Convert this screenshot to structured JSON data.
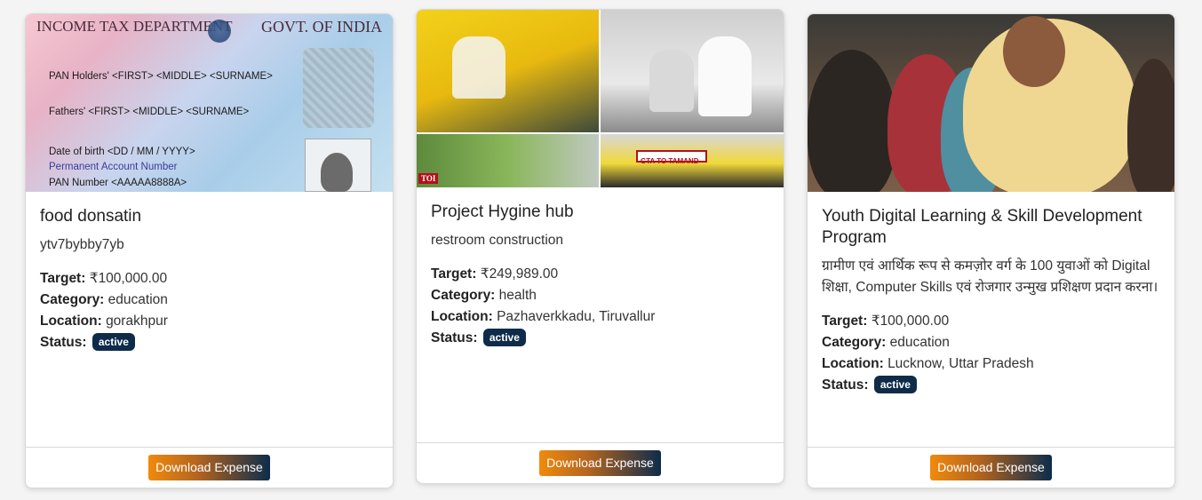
{
  "cards": [
    {
      "image_alt": "",
      "pan_card": {
        "header_left": "INCOME TAX DEPARTMENT",
        "header_right": "GOVT. OF INDIA",
        "line1": "PAN Holders' <FIRST> <MIDDLE> <SURNAME>",
        "line2": "Fathers' <FIRST> <MIDDLE> <SURNAME>",
        "line3": "Date of birth <DD / MM / YYYY>",
        "line4": "Permanent Account Number",
        "line5": "PAN Number <AAAAA8888A>"
      },
      "title": "food donsatin",
      "description": "ytv7bybby7yb",
      "target_label": "Target:",
      "target_value": "₹100,000.00",
      "category_label": "Category:",
      "category_value": "education",
      "location_label": "Location:",
      "location_value": "gorakhpur",
      "status_label": "Status:",
      "status_value": "active",
      "button_label": "Download Expense"
    },
    {
      "collage": {
        "toi_badge": "TOI",
        "bus_sign": "GTA TO TAMAND"
      },
      "title": "Project Hygine hub",
      "description": "restroom construction",
      "target_label": "Target:",
      "target_value": "₹249,989.00",
      "category_label": "Category:",
      "category_value": "health",
      "location_label": "Location:",
      "location_value": "Pazhaverkkadu, Tiruvallur",
      "status_label": "Status:",
      "status_value": "active",
      "button_label": "Download Expense"
    },
    {
      "title": "Youth Digital Learning & Skill Development Program",
      "description": "ग्रामीण एवं आर्थिक रूप से कमज़ोर वर्ग के 100 युवाओं को Digital शिक्षा, Computer Skills एवं रोजगार उन्मुख प्रशिक्षण प्रदान करना।",
      "target_label": "Target:",
      "target_value": "₹100,000.00",
      "category_label": "Category:",
      "category_value": "education",
      "location_label": "Location:",
      "location_value": "Lucknow, Uttar Pradesh",
      "status_label": "Status:",
      "status_value": "active",
      "button_label": "Download Expense"
    }
  ],
  "colors": {
    "badge": "#0e2c4a",
    "button_start": "#f08a0c",
    "button_end": "#0d2c4b"
  }
}
